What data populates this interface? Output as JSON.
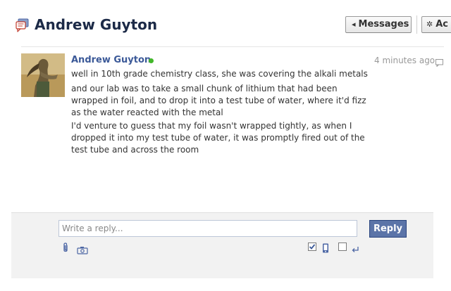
{
  "header": {
    "title": "Andrew Guyton",
    "title_icon": "messages-icon",
    "messages_button": "Messages",
    "actions_button": "Ac"
  },
  "message": {
    "author": "Andrew Guyton",
    "online": true,
    "timestamp": "4 minutes ago",
    "paragraphs": [
      "well in 10th grade chemistry class, she was covering the alkali metals",
      "and our lab was to take a small chunk of lithium that had been wrapped in foil, and to drop it into a test tube of water, where it'd fizz as the water reacted with the metal",
      "I'd venture to guess that my foil wasn't wrapped tightly, as when I dropped it into my test tube of water, it was promptly fired out of the test tube and across the room"
    ]
  },
  "reply": {
    "placeholder": "Write a reply...",
    "button": "Reply",
    "checkbox_1_checked": true,
    "checkbox_2_checked": false
  },
  "colors": {
    "title": "#1c2a47",
    "link": "#3b5998",
    "online": "#42b72a",
    "reply_button": "#5b74a8"
  }
}
